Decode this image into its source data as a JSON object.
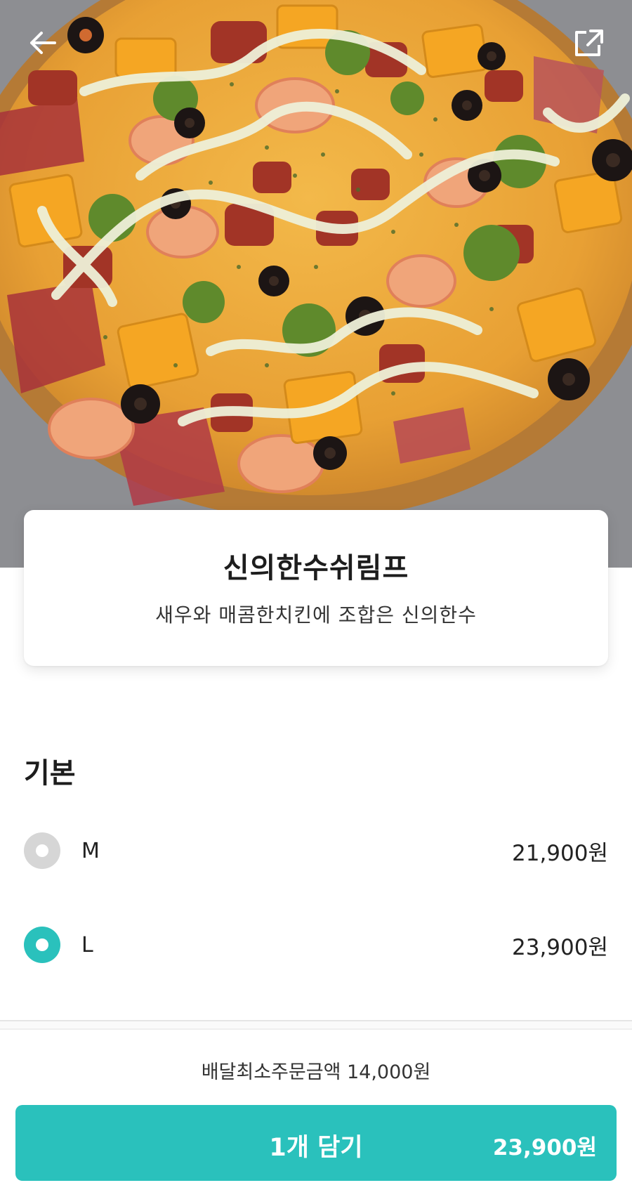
{
  "nav": {
    "back_icon": "arrow-left-icon",
    "share_icon": "share-icon"
  },
  "menu": {
    "name": "신의한수쉬림프",
    "description": "새우와 매콤한치킨에 조합은 신의한수"
  },
  "options": {
    "section_title": "기본",
    "items": [
      {
        "label": "M",
        "price": "21,900원",
        "selected": false
      },
      {
        "label": "L",
        "price": "23,900원",
        "selected": true
      }
    ]
  },
  "footer": {
    "min_order": "배달최소주문금액 14,000원",
    "cart_label": "1개 담기",
    "cart_price": "23,900원"
  },
  "colors": {
    "accent": "#2ac1bc",
    "radio_off": "#d6d6d6"
  }
}
